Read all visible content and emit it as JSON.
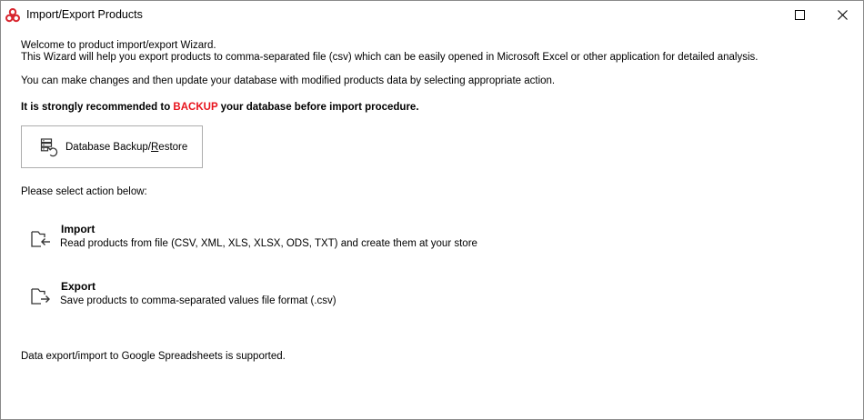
{
  "window": {
    "title": "Import/Export Products",
    "app_icon": "app-logo-icon",
    "controls": {
      "maximize": "maximize-icon",
      "close": "close-icon"
    }
  },
  "intro": {
    "line1": "Welcome to product import/export Wizard.",
    "line2": "This Wizard will help you export products to comma-separated file (csv) which can be easily opened in Microsoft Excel or other application for detailed analysis.",
    "line3": "You can make changes and then update your database with modified products data by selecting appropriate action."
  },
  "warning": {
    "before": "It is strongly recommended to ",
    "highlight": "BACKUP",
    "after": " your database before import procedure.",
    "highlight_color": "#e8131c"
  },
  "backup_button": {
    "label_before": "Database Backup/",
    "label_underlined": "R",
    "label_after": "estore",
    "icon": "database-backup-icon"
  },
  "select_label": "Please select action below:",
  "actions": [
    {
      "title": "Import",
      "description": "Read products from file (CSV, XML, XLS, XLSX, ODS, TXT) and create them at your store",
      "icon": "import-folder-icon"
    },
    {
      "title": "Export",
      "description": "Save products to comma-separated values file format (.csv)",
      "icon": "export-folder-icon"
    }
  ],
  "footer": "Data export/import to Google Spreadsheets is supported."
}
